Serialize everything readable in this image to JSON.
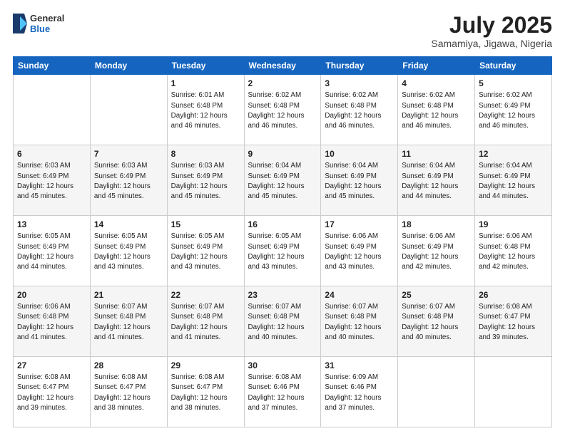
{
  "header": {
    "logo_general": "General",
    "logo_blue": "Blue",
    "title": "July 2025",
    "location": "Samamiya, Jigawa, Nigeria"
  },
  "days_of_week": [
    "Sunday",
    "Monday",
    "Tuesday",
    "Wednesday",
    "Thursday",
    "Friday",
    "Saturday"
  ],
  "weeks": [
    [
      {
        "day": "",
        "info": ""
      },
      {
        "day": "",
        "info": ""
      },
      {
        "day": "1",
        "info": "Sunrise: 6:01 AM\nSunset: 6:48 PM\nDaylight: 12 hours and 46 minutes."
      },
      {
        "day": "2",
        "info": "Sunrise: 6:02 AM\nSunset: 6:48 PM\nDaylight: 12 hours and 46 minutes."
      },
      {
        "day": "3",
        "info": "Sunrise: 6:02 AM\nSunset: 6:48 PM\nDaylight: 12 hours and 46 minutes."
      },
      {
        "day": "4",
        "info": "Sunrise: 6:02 AM\nSunset: 6:48 PM\nDaylight: 12 hours and 46 minutes."
      },
      {
        "day": "5",
        "info": "Sunrise: 6:02 AM\nSunset: 6:49 PM\nDaylight: 12 hours and 46 minutes."
      }
    ],
    [
      {
        "day": "6",
        "info": "Sunrise: 6:03 AM\nSunset: 6:49 PM\nDaylight: 12 hours and 45 minutes."
      },
      {
        "day": "7",
        "info": "Sunrise: 6:03 AM\nSunset: 6:49 PM\nDaylight: 12 hours and 45 minutes."
      },
      {
        "day": "8",
        "info": "Sunrise: 6:03 AM\nSunset: 6:49 PM\nDaylight: 12 hours and 45 minutes."
      },
      {
        "day": "9",
        "info": "Sunrise: 6:04 AM\nSunset: 6:49 PM\nDaylight: 12 hours and 45 minutes."
      },
      {
        "day": "10",
        "info": "Sunrise: 6:04 AM\nSunset: 6:49 PM\nDaylight: 12 hours and 45 minutes."
      },
      {
        "day": "11",
        "info": "Sunrise: 6:04 AM\nSunset: 6:49 PM\nDaylight: 12 hours and 44 minutes."
      },
      {
        "day": "12",
        "info": "Sunrise: 6:04 AM\nSunset: 6:49 PM\nDaylight: 12 hours and 44 minutes."
      }
    ],
    [
      {
        "day": "13",
        "info": "Sunrise: 6:05 AM\nSunset: 6:49 PM\nDaylight: 12 hours and 44 minutes."
      },
      {
        "day": "14",
        "info": "Sunrise: 6:05 AM\nSunset: 6:49 PM\nDaylight: 12 hours and 43 minutes."
      },
      {
        "day": "15",
        "info": "Sunrise: 6:05 AM\nSunset: 6:49 PM\nDaylight: 12 hours and 43 minutes."
      },
      {
        "day": "16",
        "info": "Sunrise: 6:05 AM\nSunset: 6:49 PM\nDaylight: 12 hours and 43 minutes."
      },
      {
        "day": "17",
        "info": "Sunrise: 6:06 AM\nSunset: 6:49 PM\nDaylight: 12 hours and 43 minutes."
      },
      {
        "day": "18",
        "info": "Sunrise: 6:06 AM\nSunset: 6:49 PM\nDaylight: 12 hours and 42 minutes."
      },
      {
        "day": "19",
        "info": "Sunrise: 6:06 AM\nSunset: 6:48 PM\nDaylight: 12 hours and 42 minutes."
      }
    ],
    [
      {
        "day": "20",
        "info": "Sunrise: 6:06 AM\nSunset: 6:48 PM\nDaylight: 12 hours and 41 minutes."
      },
      {
        "day": "21",
        "info": "Sunrise: 6:07 AM\nSunset: 6:48 PM\nDaylight: 12 hours and 41 minutes."
      },
      {
        "day": "22",
        "info": "Sunrise: 6:07 AM\nSunset: 6:48 PM\nDaylight: 12 hours and 41 minutes."
      },
      {
        "day": "23",
        "info": "Sunrise: 6:07 AM\nSunset: 6:48 PM\nDaylight: 12 hours and 40 minutes."
      },
      {
        "day": "24",
        "info": "Sunrise: 6:07 AM\nSunset: 6:48 PM\nDaylight: 12 hours and 40 minutes."
      },
      {
        "day": "25",
        "info": "Sunrise: 6:07 AM\nSunset: 6:48 PM\nDaylight: 12 hours and 40 minutes."
      },
      {
        "day": "26",
        "info": "Sunrise: 6:08 AM\nSunset: 6:47 PM\nDaylight: 12 hours and 39 minutes."
      }
    ],
    [
      {
        "day": "27",
        "info": "Sunrise: 6:08 AM\nSunset: 6:47 PM\nDaylight: 12 hours and 39 minutes."
      },
      {
        "day": "28",
        "info": "Sunrise: 6:08 AM\nSunset: 6:47 PM\nDaylight: 12 hours and 38 minutes."
      },
      {
        "day": "29",
        "info": "Sunrise: 6:08 AM\nSunset: 6:47 PM\nDaylight: 12 hours and 38 minutes."
      },
      {
        "day": "30",
        "info": "Sunrise: 6:08 AM\nSunset: 6:46 PM\nDaylight: 12 hours and 37 minutes."
      },
      {
        "day": "31",
        "info": "Sunrise: 6:09 AM\nSunset: 6:46 PM\nDaylight: 12 hours and 37 minutes."
      },
      {
        "day": "",
        "info": ""
      },
      {
        "day": "",
        "info": ""
      }
    ]
  ]
}
